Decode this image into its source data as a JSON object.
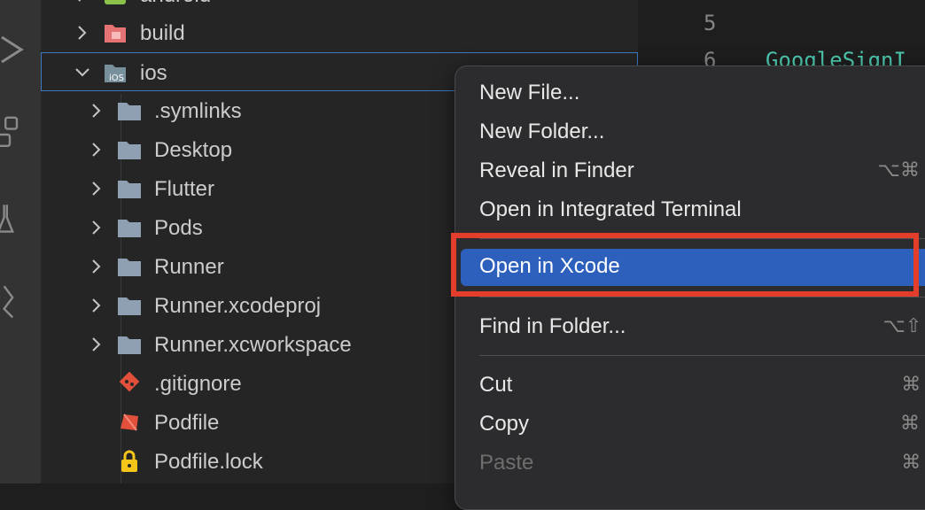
{
  "explorer": {
    "top_partial": "android",
    "items": [
      {
        "label": "build",
        "type": "folder-build",
        "expanded": false
      },
      {
        "label": "ios",
        "type": "folder-ios",
        "expanded": true,
        "selected": true
      },
      {
        "label": ".symlinks",
        "type": "folder"
      },
      {
        "label": "Desktop",
        "type": "folder"
      },
      {
        "label": "Flutter",
        "type": "folder"
      },
      {
        "label": "Pods",
        "type": "folder"
      },
      {
        "label": "Runner",
        "type": "folder"
      },
      {
        "label": "Runner.xcodeproj",
        "type": "folder"
      },
      {
        "label": "Runner.xcworkspace",
        "type": "folder"
      },
      {
        "label": ".gitignore",
        "type": "git-file"
      },
      {
        "label": "Podfile",
        "type": "ruby-file"
      },
      {
        "label": "Podfile.lock",
        "type": "lock-file"
      }
    ]
  },
  "editor": {
    "line_numbers": [
      "5",
      "6"
    ],
    "line6_code": "GoogleSignI"
  },
  "context_menu": {
    "items": [
      {
        "label": "New File...",
        "shortcut": ""
      },
      {
        "label": "New Folder...",
        "shortcut": ""
      },
      {
        "label": "Reveal in Finder",
        "shortcut": "⌥⌘ R"
      },
      {
        "label": "Open in Integrated Terminal",
        "shortcut": ""
      },
      {
        "label": "Open in Xcode",
        "shortcut": "",
        "active": true
      },
      {
        "label": "Find in Folder...",
        "shortcut": "⌥⇧ F"
      },
      {
        "label": "Cut",
        "shortcut": "⌘ X"
      },
      {
        "label": "Copy",
        "shortcut": "⌘ C"
      },
      {
        "label": "Paste",
        "shortcut": "⌘ V",
        "disabled": true
      }
    ]
  },
  "colors": {
    "highlight_box": "#e33d2b",
    "menu_active": "#2d5fbd",
    "folder": "#8fa0b3",
    "selection_border": "#3a79c4"
  }
}
